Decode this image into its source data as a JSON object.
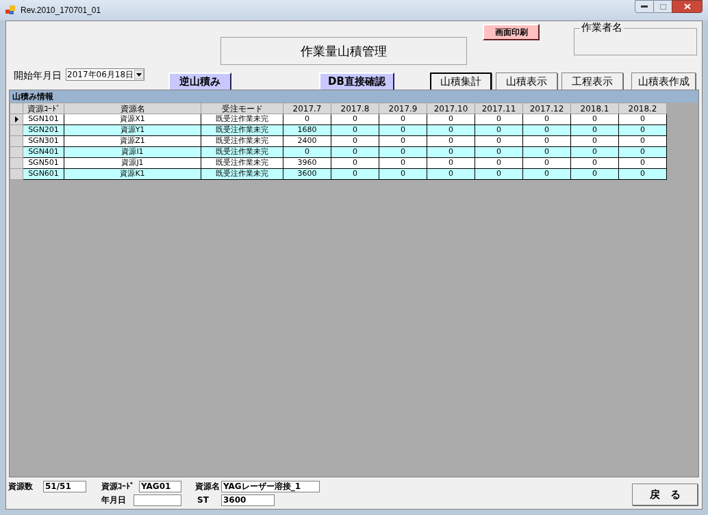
{
  "window": {
    "title": "Rev.2010_170701_01"
  },
  "print_button": {
    "label": "画面印刷"
  },
  "worker_group": {
    "label": "作業者名"
  },
  "screen_title": "作業量山積管理",
  "start_date": {
    "label": "開始年月日",
    "value": "2017年06月18日"
  },
  "buttons": [
    {
      "label": "逆山積み",
      "kind": "lavender",
      "focused": false
    },
    {
      "label": "DB直接確認",
      "kind": "lavender",
      "focused": false
    },
    {
      "label": "山積集計",
      "kind": "plain",
      "focused": true
    },
    {
      "label": "山積表示",
      "kind": "plain",
      "focused": false
    },
    {
      "label": "工程表示",
      "kind": "plain",
      "focused": false
    },
    {
      "label": "山積表作成",
      "kind": "plain",
      "focused": false
    }
  ],
  "grid": {
    "title": "山積み情報",
    "columns": [
      "資源ｺｰﾄﾞ",
      "資源名",
      "受注モード",
      "2017.7",
      "2017.8",
      "2017.9",
      "2017.10",
      "2017.11",
      "2017.12",
      "2018.1",
      "2018.2"
    ],
    "rows": [
      {
        "current": true,
        "cells": [
          "SGN101",
          "資源X1",
          "既受注作業未完",
          "0",
          "0",
          "0",
          "0",
          "0",
          "0",
          "0",
          "0"
        ]
      },
      {
        "current": false,
        "cells": [
          "SGN201",
          "資源Y1",
          "既受注作業未完",
          "1680",
          "0",
          "0",
          "0",
          "0",
          "0",
          "0",
          "0"
        ]
      },
      {
        "current": false,
        "cells": [
          "SGN301",
          "資源Z1",
          "既受注作業未完",
          "2400",
          "0",
          "0",
          "0",
          "0",
          "0",
          "0",
          "0"
        ]
      },
      {
        "current": false,
        "cells": [
          "SGN401",
          "資源I1",
          "既受注作業未完",
          "0",
          "0",
          "0",
          "0",
          "0",
          "0",
          "0",
          "0"
        ]
      },
      {
        "current": false,
        "cells": [
          "SGN501",
          "資源J1",
          "既受注作業未完",
          "3960",
          "0",
          "0",
          "0",
          "0",
          "0",
          "0",
          "0"
        ]
      },
      {
        "current": false,
        "cells": [
          "SGN601",
          "資源K1",
          "既受注作業未完",
          "3600",
          "0",
          "0",
          "0",
          "0",
          "0",
          "0",
          "0"
        ]
      }
    ]
  },
  "footer": {
    "resource_count": {
      "label": "資源数",
      "value": "51/51"
    },
    "resource_code": {
      "label": "資源ｺｰﾄﾞ",
      "value": "YAG01"
    },
    "resource_name": {
      "label": "資源名",
      "value": "YAGレーザー溶接_1"
    },
    "date": {
      "label": "年月日"
    },
    "st": {
      "label": "ST",
      "value": "3600"
    }
  },
  "back_button": {
    "label": "戻　る"
  }
}
